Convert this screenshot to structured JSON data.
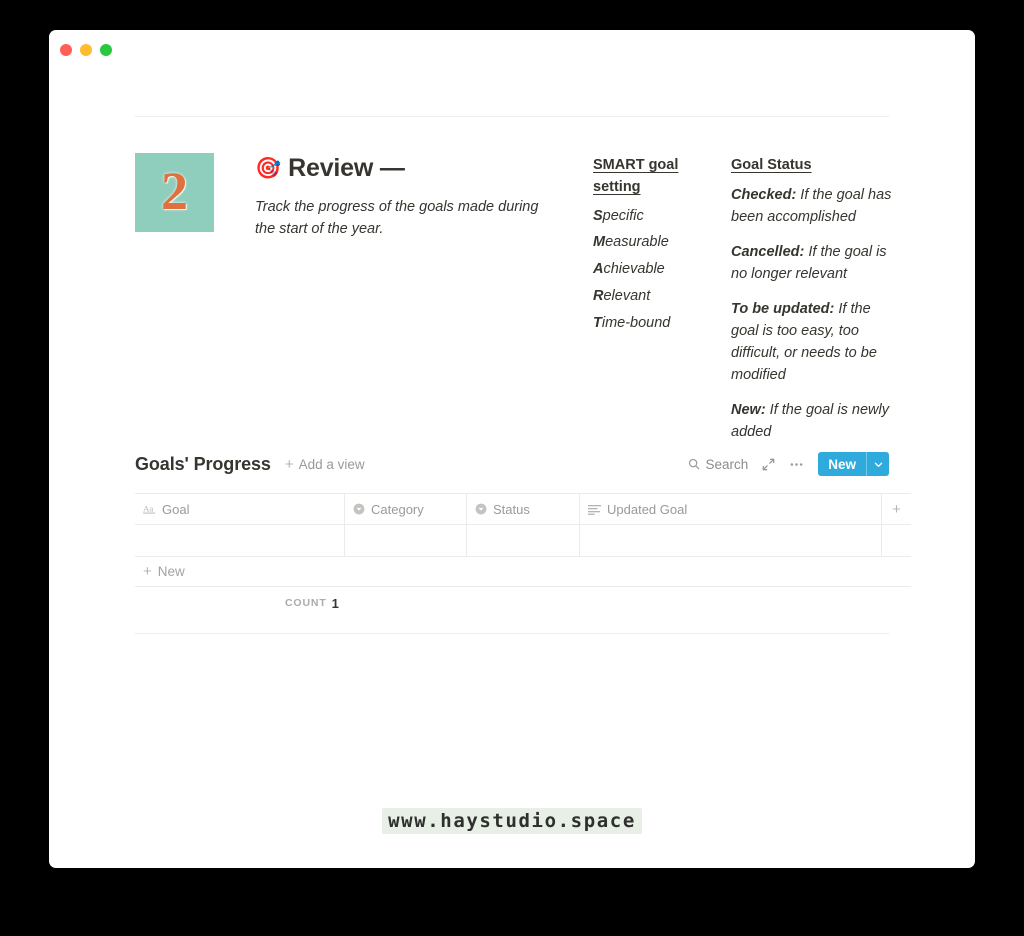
{
  "window": {
    "traffic_lights": [
      "close",
      "minimize",
      "zoom"
    ],
    "colors": {
      "close": "#ff5f57",
      "minimize": "#febc2e",
      "zoom": "#28c840"
    }
  },
  "hero": {
    "number": "2",
    "number_tile_bg": "#8fcdbc",
    "number_color": "#e0713d",
    "emoji": "🎯",
    "title": "Review —",
    "subtitle": "Track the progress of the goals made during the start of the year."
  },
  "smart": {
    "heading": "SMART goal setting",
    "items": [
      {
        "initial": "S",
        "rest": "pecific"
      },
      {
        "initial": "M",
        "rest": "easurable"
      },
      {
        "initial": "A",
        "rest": "chievable"
      },
      {
        "initial": "R",
        "rest": "elevant"
      },
      {
        "initial": "T",
        "rest": "ime-bound"
      }
    ]
  },
  "goal_status": {
    "heading": "Goal Status",
    "items": [
      {
        "term": "Checked:",
        "definition": " If the goal has been accomplished"
      },
      {
        "term": "Cancelled:",
        "definition": " If the goal is no longer relevant"
      },
      {
        "term": "To be updated:",
        "definition": " If the goal is too easy, too difficult, or needs to be modified"
      },
      {
        "term": "New:",
        "definition": " If the goal is newly added"
      }
    ]
  },
  "database": {
    "title": "Goals' Progress",
    "add_view_label": "Add a view",
    "search_label": "Search",
    "new_button_label": "New",
    "accent_color": "#2eaadc",
    "columns": [
      {
        "label": "Goal",
        "icon": "text-type-icon"
      },
      {
        "label": "Category",
        "icon": "select-type-icon"
      },
      {
        "label": "Status",
        "icon": "select-type-icon"
      },
      {
        "label": "Updated Goal",
        "icon": "rich-text-type-icon"
      }
    ],
    "rows": [
      {
        "goal": "",
        "category": "",
        "status": "",
        "updated_goal": ""
      }
    ],
    "new_row_label": "New",
    "count_label": "COUNT",
    "count_value": "1"
  },
  "footer": {
    "watermark": "www.haystudio.space"
  }
}
